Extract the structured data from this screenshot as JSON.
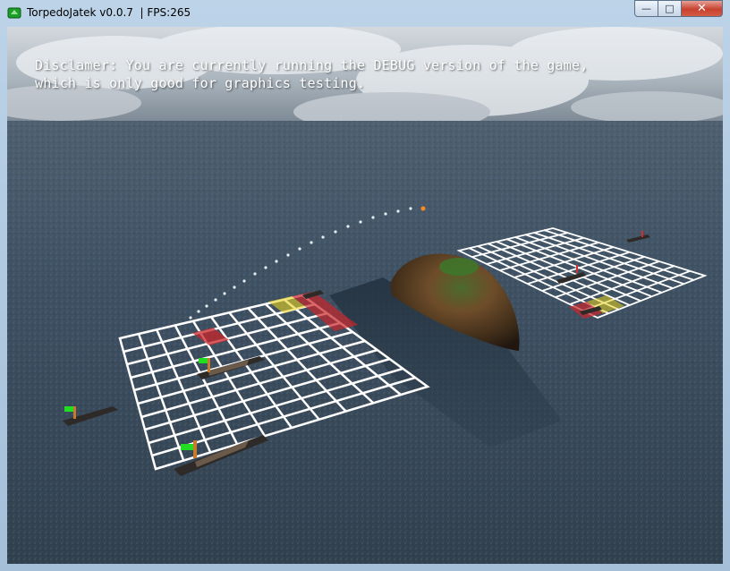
{
  "window": {
    "title": "TorpedoJatek v0.0.7  | FPS:265",
    "controls": {
      "minimize": "—",
      "maximize": "□",
      "close": "✕"
    }
  },
  "game": {
    "disclaimer_line1": "Disclamer: You are currently running the DEBUG version of the game,",
    "disclaimer_line2": "which is only good for graphics testing.",
    "colors": {
      "sea": "#3f5264",
      "grid": "#ffffff",
      "hit_cell": "#c8252a",
      "target_cell": "#e8d21e",
      "flag": "#22dd22",
      "island": "#6b4a2a"
    },
    "icons": [
      "app-icon",
      "minimize-icon",
      "maximize-icon",
      "close-icon"
    ]
  }
}
